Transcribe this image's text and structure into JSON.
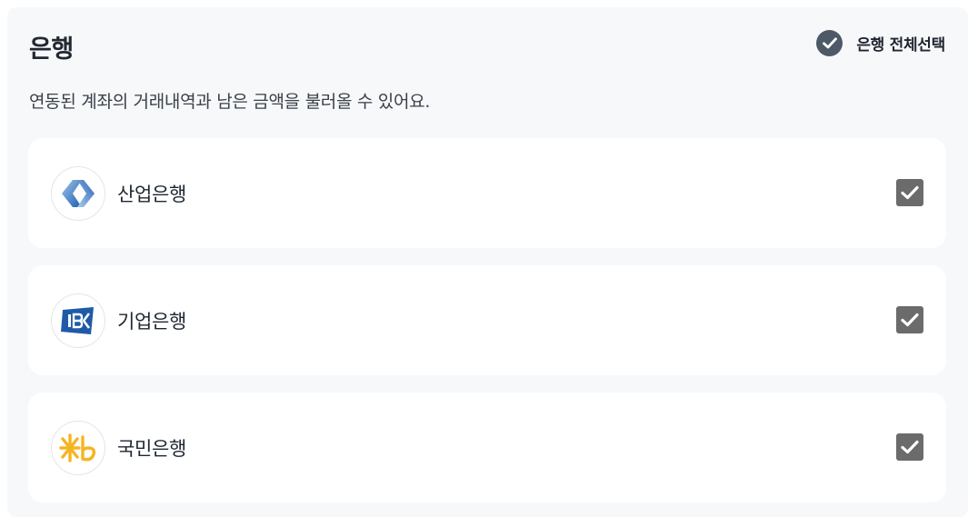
{
  "section": {
    "title": "은행",
    "select_all_label": "은행 전체선택",
    "description": "연동된 계좌의 거래내역과 남은 금액을 불러올 수 있어요."
  },
  "banks": [
    {
      "name": "산업은행",
      "logo": "kdb-logo",
      "checked": true
    },
    {
      "name": "기업은행",
      "logo": "ibk-logo",
      "checked": true
    },
    {
      "name": "국민은행",
      "logo": "kb-logo",
      "checked": true
    }
  ],
  "colors": {
    "panel_bg": "#f7f8fa",
    "card_bg": "#ffffff",
    "checkbox": "#6b6b6b",
    "select_all_circle": "#4e5968",
    "kdb_blue": "#2f6fbd",
    "ibk_blue": "#1f5aa8",
    "kb_yellow": "#f5b520"
  }
}
